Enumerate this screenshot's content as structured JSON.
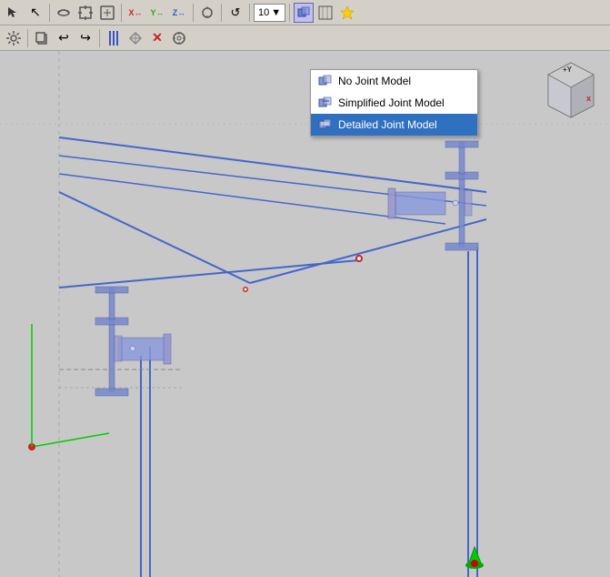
{
  "toolbar1": {
    "buttons": [
      {
        "name": "select-mode",
        "label": "↖",
        "icon": "cursor-icon"
      },
      {
        "name": "separator1"
      },
      {
        "name": "orbit",
        "label": "⟳",
        "icon": "orbit-icon"
      },
      {
        "name": "zoom-box",
        "label": "□",
        "icon": "zoom-box-icon"
      },
      {
        "name": "zoom-all",
        "label": "⊞",
        "icon": "zoom-all-icon"
      },
      {
        "name": "separator2"
      },
      {
        "name": "move-x",
        "label": "X↔",
        "icon": "move-x-icon"
      },
      {
        "name": "move-y",
        "label": "Y↔",
        "icon": "move-y-icon"
      },
      {
        "name": "move-z",
        "label": "Z↔",
        "icon": "move-z-icon"
      },
      {
        "name": "separator3"
      },
      {
        "name": "rotate",
        "label": "↺",
        "icon": "rotate-icon"
      },
      {
        "name": "separator4"
      },
      {
        "name": "snap",
        "label": "⊙",
        "icon": "snap-icon"
      },
      {
        "name": "separator5"
      },
      {
        "name": "num-field",
        "label": "10",
        "type": "dropdown"
      },
      {
        "name": "separator6"
      },
      {
        "name": "joint-model-btn",
        "label": "⊞",
        "icon": "joint-model-icon"
      },
      {
        "name": "grid-btn",
        "label": "⊟",
        "icon": "grid-icon"
      },
      {
        "name": "highlight-btn",
        "label": "☆",
        "icon": "highlight-icon"
      }
    ]
  },
  "toolbar2": {
    "buttons": [
      {
        "name": "settings",
        "label": "⚙",
        "icon": "settings-icon"
      },
      {
        "name": "sep1"
      },
      {
        "name": "copy",
        "label": "⎘",
        "icon": "copy-icon"
      },
      {
        "name": "undo",
        "label": "↩",
        "icon": "undo-icon"
      },
      {
        "name": "redo",
        "label": "↪",
        "icon": "redo-icon"
      },
      {
        "name": "sep2"
      },
      {
        "name": "columns",
        "label": "|||",
        "icon": "columns-icon"
      },
      {
        "name": "mirror",
        "label": "⌖",
        "icon": "mirror-icon"
      },
      {
        "name": "delete",
        "label": "✕",
        "icon": "delete-icon"
      },
      {
        "name": "properties",
        "label": "⚙",
        "icon": "properties-icon"
      }
    ]
  },
  "dropdown_menu": {
    "items": [
      {
        "id": "no-joint",
        "label": "No Joint Model",
        "selected": false
      },
      {
        "id": "simplified",
        "label": "Simplified Joint Model",
        "selected": false
      },
      {
        "id": "detailed",
        "label": "Detailed Joint Model",
        "selected": true
      }
    ]
  },
  "viewport": {
    "background": "#c8c8c8"
  },
  "navcube": {
    "plusY": "+Y",
    "minusX": "x"
  }
}
